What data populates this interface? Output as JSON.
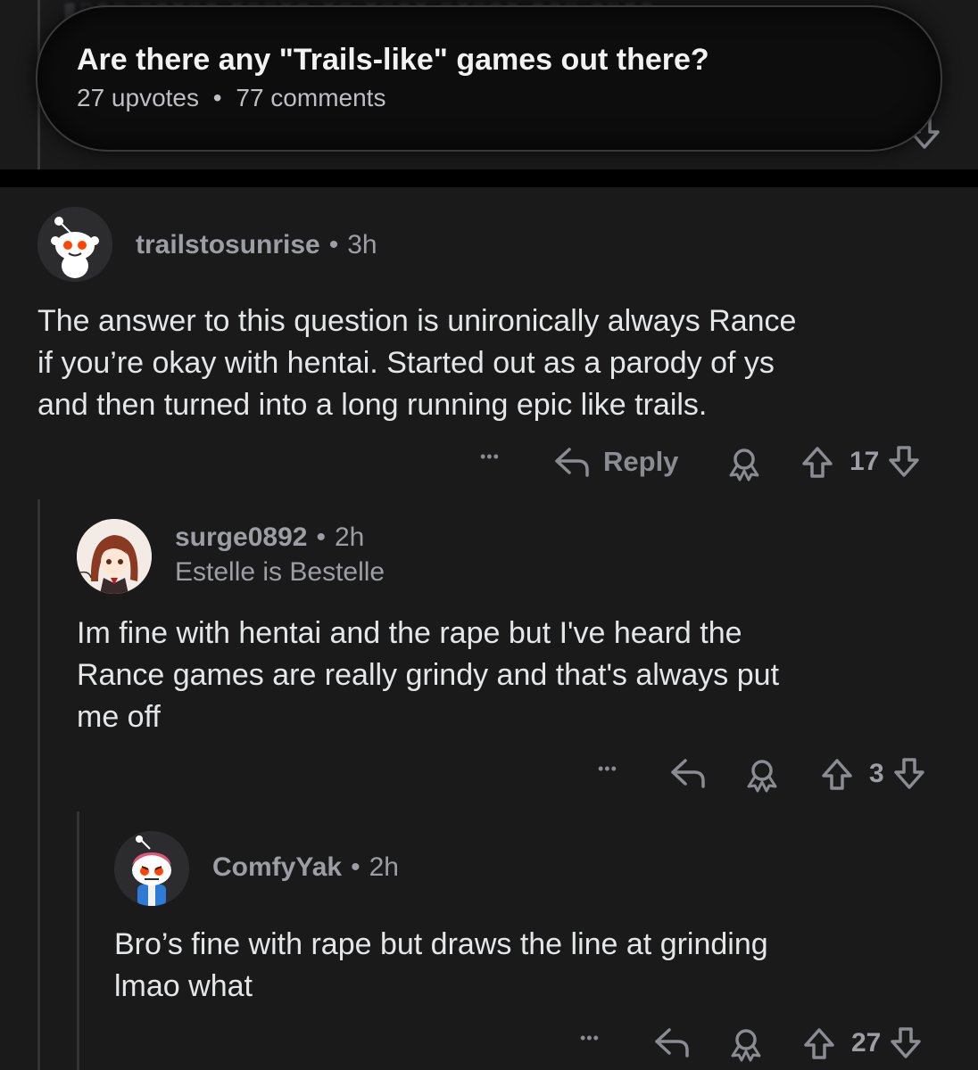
{
  "post": {
    "title": "Are there any \"Trails-like\" games out there?",
    "upvotes": "27 upvotes",
    "comments_count": "77 comments",
    "separator": "•"
  },
  "comments": [
    {
      "username": "trailstosunrise",
      "time": "3h",
      "body_lines": [
        "The answer to this question is unironically always Rance",
        "if you’re okay with hentai. Started out as a parody of ys",
        "and then turned into a long running epic like trails."
      ],
      "reply_label": "Reply",
      "score": "17"
    },
    {
      "username": "surge0892",
      "time": "2h",
      "flair": "Estelle is Bestelle",
      "body_lines": [
        "Im fine with hentai and the rape but I've heard the",
        "Rance games are really grindy and that's always put",
        "me off"
      ],
      "score": "3"
    },
    {
      "username": "ComfyYak",
      "time": "2h",
      "body_lines": [
        "Bro’s fine with rape but draws the line at grinding",
        "lmao what"
      ],
      "score": "27"
    }
  ],
  "ui": {
    "separator": "•",
    "more": "•••"
  },
  "icons": {
    "more": "more-options-icon",
    "reply": "reply-arrow-icon",
    "award": "award-icon",
    "upvote": "upvote-arrow-icon",
    "downvote": "downvote-arrow-icon"
  },
  "colors": {
    "background": "#1a1a1b",
    "avatar_red": "#ff4500",
    "meta_text": "#9c9ea3"
  }
}
